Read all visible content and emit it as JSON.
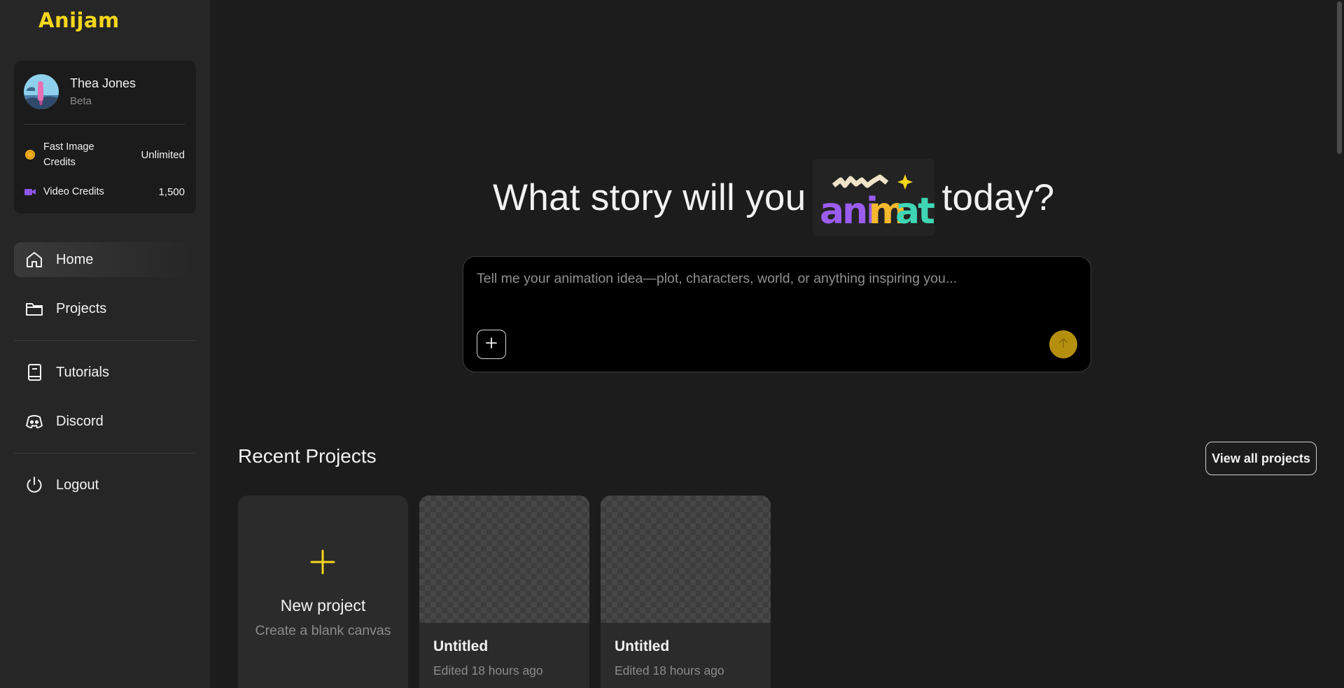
{
  "brand": {
    "logo_text": "Anijam",
    "logo_color": "#f5d61a"
  },
  "user": {
    "name": "Thea Jones",
    "tier": "Beta"
  },
  "credits": [
    {
      "icon": "coin-icon",
      "label": "Fast Image Credits",
      "value": "Unlimited"
    },
    {
      "icon": "video-camera-icon",
      "label": "Video Credits",
      "value": "1,500"
    }
  ],
  "nav": {
    "home": "Home",
    "projects": "Projects",
    "tutorials": "Tutorials",
    "discord": "Discord",
    "logout": "Logout"
  },
  "hero": {
    "headline_before": "What story will you",
    "headline_word": "animate",
    "headline_after": "today?",
    "prompt_placeholder": "Tell me your animation idea—plot, characters, world, or anything inspiring you..."
  },
  "recent": {
    "title": "Recent Projects",
    "view_all": "View all projects",
    "new_project_title": "New project",
    "new_project_sub": "Create a blank canvas",
    "projects": [
      {
        "name": "Untitled",
        "edited": "Edited 18 hours ago"
      },
      {
        "name": "Untitled",
        "edited": "Edited 18 hours ago"
      }
    ]
  },
  "colors": {
    "accent": "#f5d61a",
    "send_button": "#b5900f",
    "background": "#1c1c1c",
    "sidebar": "#262626"
  }
}
